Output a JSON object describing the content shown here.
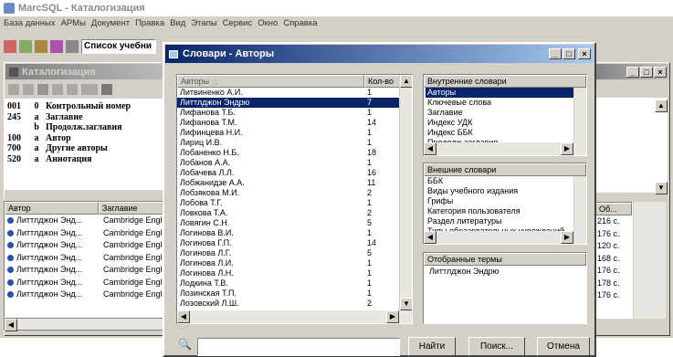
{
  "app": {
    "title": "MarcSQL - Каталогизация",
    "menu": [
      "База данных",
      "АРМы",
      "Документ",
      "Правка",
      "Вид",
      "Этапы",
      "Сервис",
      "Окно",
      "Справка"
    ],
    "toolbar_combo": "Список учебни"
  },
  "catalog": {
    "title": "Каталогизация",
    "marc_fields": [
      {
        "tag": "001",
        "ind": "0",
        "name": "Контрольный номер"
      },
      {
        "tag": "245",
        "ind": "a",
        "name": "Заглавие"
      },
      {
        "tag": "",
        "ind": "b",
        "name": "Продолж.заглавия"
      },
      {
        "tag": "100",
        "ind": "a",
        "name": "Автор"
      },
      {
        "tag": "700",
        "ind": "a",
        "name": "Другие авторы"
      },
      {
        "tag": "520",
        "ind": "a",
        "name": "Аннотация"
      }
    ],
    "columns": {
      "author": "Автор",
      "title": "Заглавие",
      "pages": "Об..."
    },
    "rows": [
      {
        "author": "Литтлджон Энд...",
        "title": "Cambridge Engl",
        "pages": "216 с."
      },
      {
        "author": "Литтлджон Энд...",
        "title": "Cambridge Engl",
        "pages": "176 с."
      },
      {
        "author": "Литтлджон Энд...",
        "title": "Cambridge Engl",
        "pages": "120 с."
      },
      {
        "author": "Литтлджон Энд...",
        "title": "Cambridge Engl",
        "pages": "168 с."
      },
      {
        "author": "Литтлджон Энд...",
        "title": "Cambridge Engl",
        "pages": "176 с."
      },
      {
        "author": "Литтлджон Энд...",
        "title": "Cambridge Engl",
        "pages": "178 с."
      },
      {
        "author": "Литтлджон Энд...",
        "title": "Cambridge Engl",
        "pages": "176 с."
      }
    ]
  },
  "dialog": {
    "title": "Словари - Авторы",
    "col_authors": "Авторы",
    "col_count": "Кол-во",
    "authors": [
      {
        "name": "Литвиненко А.И.",
        "count": "1"
      },
      {
        "name": "Литтлджон Эндрю",
        "count": "7",
        "selected": true
      },
      {
        "name": "Лифанова Т.Б.",
        "count": "1"
      },
      {
        "name": "Лифанова Т.М.",
        "count": "14"
      },
      {
        "name": "Лифинцева Н.И.",
        "count": "1"
      },
      {
        "name": "Лириц И.В.",
        "count": "1"
      },
      {
        "name": "Лобаненко Н.Б.",
        "count": "18"
      },
      {
        "name": "Лобанов А.А.",
        "count": "1"
      },
      {
        "name": "Лобачева Л.Л.",
        "count": "16"
      },
      {
        "name": "Лобжанидзе А.А.",
        "count": "11"
      },
      {
        "name": "Лобзякова М.И.",
        "count": "2"
      },
      {
        "name": "Лобова Т.Г.",
        "count": "1"
      },
      {
        "name": "Ловкова Т.А.",
        "count": "2"
      },
      {
        "name": "Ловягин С.Н.",
        "count": "5"
      },
      {
        "name": "Логинова В.И.",
        "count": "1"
      },
      {
        "name": "Логинова Г.П.",
        "count": "14"
      },
      {
        "name": "Логинова Л.Г.",
        "count": "5"
      },
      {
        "name": "Логинова Л.И.",
        "count": "1"
      },
      {
        "name": "Логинова Л.Н.",
        "count": "1"
      },
      {
        "name": "Лодкина Т.В.",
        "count": "1"
      },
      {
        "name": "Лозинская Т.П.",
        "count": "1"
      },
      {
        "name": "Лозовский Л.Ш.",
        "count": "2"
      }
    ],
    "internal_title": "Внутренние словари",
    "internal": [
      "Авторы",
      "Ключевые слова",
      "Заглавие",
      "Индекс УДК",
      "Индекс ББК",
      "Продолж.заглавия"
    ],
    "external_title": "Внешние словари",
    "external": [
      "ББК",
      "Виды учебного издания",
      "Грифы",
      "Категория пользователя",
      "Раздел литературы",
      "Типы образовательных учреждений"
    ],
    "selected_title": "Отобранные термы",
    "selected_terms": [
      "Литтлджон Эндрю"
    ],
    "search_value": "",
    "find_label": "Найти",
    "search_label": "Поиск...",
    "cancel_label": "Отмена"
  }
}
